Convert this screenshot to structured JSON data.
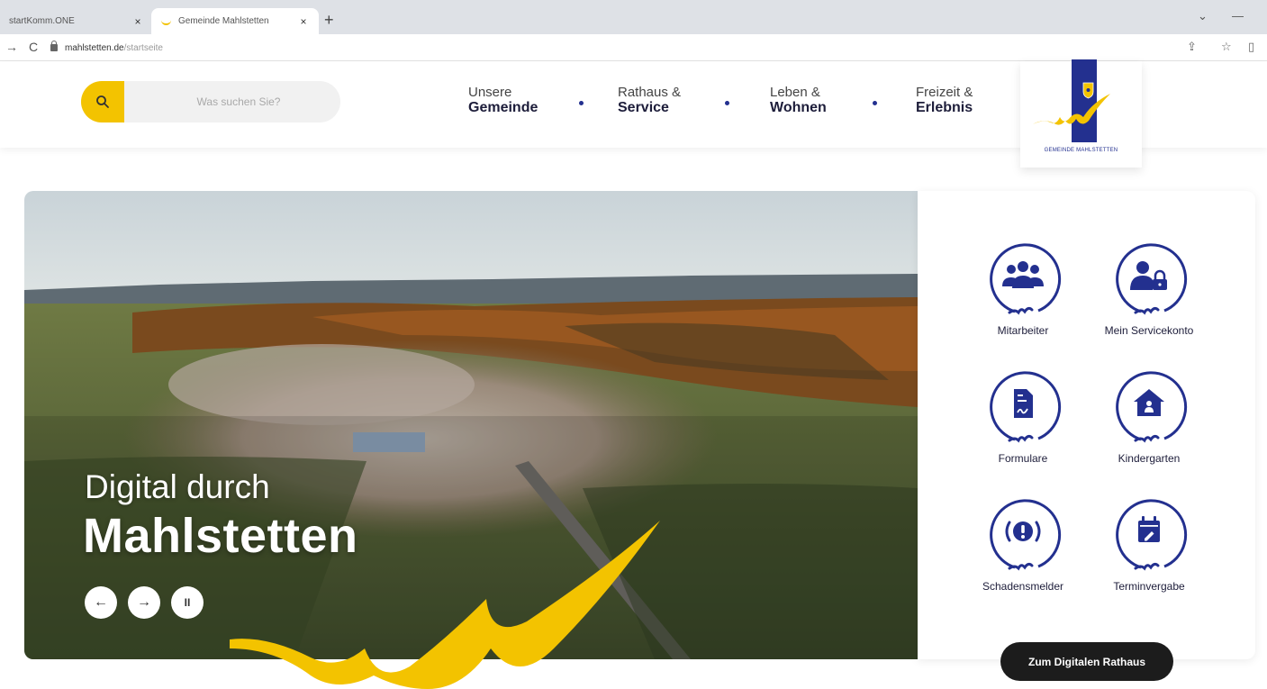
{
  "browser": {
    "tabs": [
      {
        "title": "startKomm.ONE",
        "active": false
      },
      {
        "title": "Gemeinde Mahlstetten",
        "active": true
      }
    ],
    "url_host": "mahlstetten.de",
    "url_path": "/startseite",
    "new_tab_label": "+",
    "close_label": "×"
  },
  "header": {
    "search_placeholder": "Was suchen Sie?",
    "nav": [
      {
        "line1": "Unsere",
        "line2": "Gemeinde"
      },
      {
        "line1": "Rathaus &",
        "line2": "Service"
      },
      {
        "line1": "Leben &",
        "line2": "Wohnen"
      },
      {
        "line1": "Freizeit &",
        "line2": "Erlebnis"
      }
    ],
    "logo_text": "GEMEINDE MAHLSTETTEN"
  },
  "hero": {
    "title_line1": "Digital durch",
    "title_line2": "Mahlstetten",
    "controls": {
      "prev": "←",
      "next": "→",
      "pause": "II"
    }
  },
  "services": [
    {
      "label": "Mitarbeiter",
      "icon": "users-icon"
    },
    {
      "label": "Mein Servicekonto",
      "icon": "user-lock-icon"
    },
    {
      "label": "Formulare",
      "icon": "document-icon"
    },
    {
      "label": "Kindergarten",
      "icon": "house-icon"
    },
    {
      "label": "Schadensmelder",
      "icon": "alert-icon"
    },
    {
      "label": "Terminvergabe",
      "icon": "calendar-icon"
    }
  ],
  "cta_label": "Zum Digitalen Rathaus",
  "colors": {
    "brand_blue": "#23308f",
    "brand_yellow": "#f3c300",
    "cta_bg": "#1c1c1c"
  }
}
